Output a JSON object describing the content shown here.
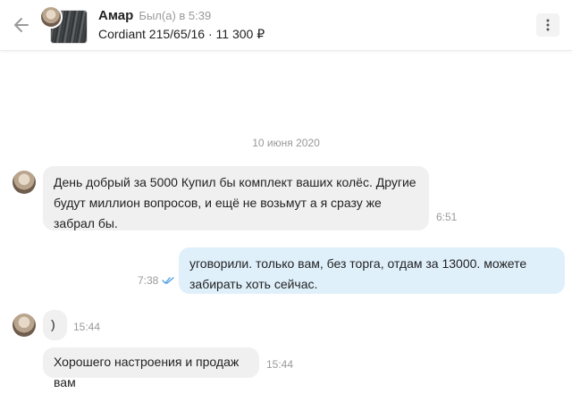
{
  "header": {
    "name": "Амар",
    "last_seen": "Был(а) в 5:39",
    "item": "Cordiant 215/65/16 · 11 300 ₽"
  },
  "chat": {
    "date": "10 июня 2020",
    "messages": [
      {
        "direction": "incoming",
        "text": "День добрый за 5000 Купил бы комплект ваших колёс. Другие будут миллион вопросов, и ещё не возьмут а я сразу же забрал бы.",
        "time": "6:51"
      },
      {
        "direction": "outgoing",
        "text": "уговорили. только вам, без торга, отдам за 13000. можете забирать хоть сейчас.",
        "time": "7:38",
        "status": "read"
      },
      {
        "direction": "incoming",
        "text": ")",
        "time": "15:44"
      },
      {
        "direction": "incoming",
        "text": "Хорошего настроения и продаж вам",
        "time": "15:44"
      }
    ]
  },
  "colors": {
    "incoming_bubble": "#f0f0f0",
    "outgoing_bubble": "#dff0fb",
    "read_ticks": "#4a9be0"
  },
  "icons": {
    "back": "arrow-left-icon",
    "menu": "more-vertical-icon",
    "status": "double-check-icon"
  }
}
